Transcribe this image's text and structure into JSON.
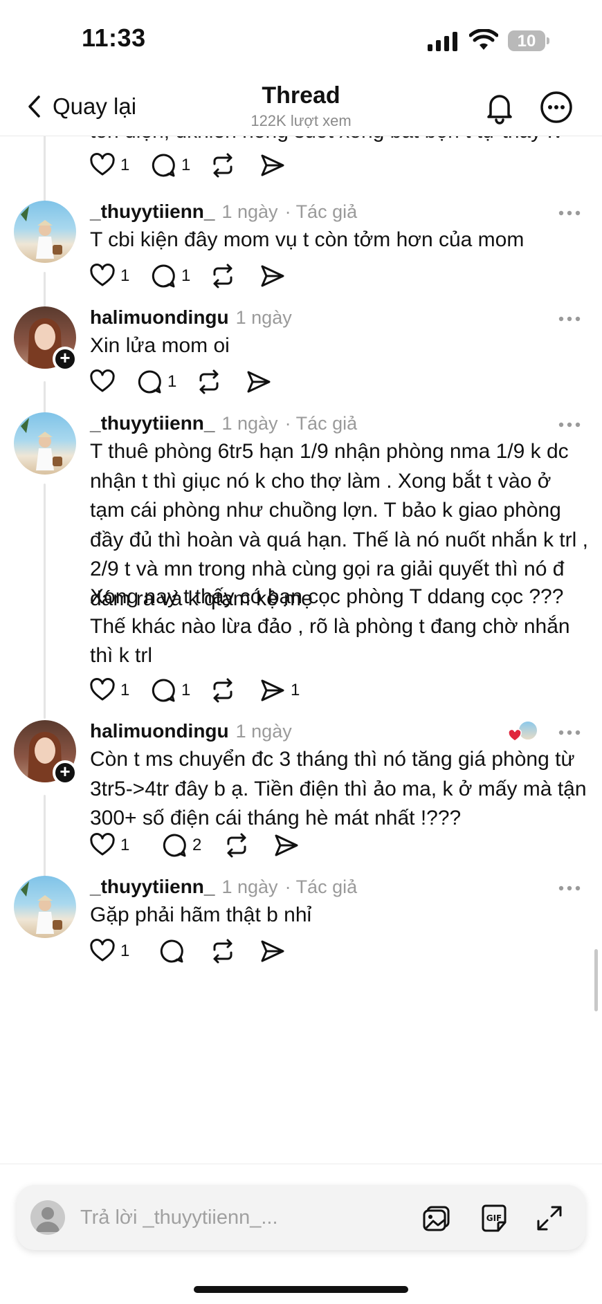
{
  "status_bar": {
    "time": "11:33",
    "battery": "10"
  },
  "header": {
    "back_label": "Quay lại",
    "title": "Thread",
    "subtitle": "122K lượt xem"
  },
  "replies": [
    {
      "username": "",
      "time": "",
      "author_tag": "",
      "text": "tốn điện, đkhien hỏng suốt xong bắt bọn t tự thay :v",
      "likes": "1",
      "comments": "1",
      "shares": ""
    },
    {
      "username": "_thuyytiienn_",
      "time": "1 ngày",
      "author_tag": "· Tác giả",
      "text": "T cbi kiện đây mom vụ t còn tởm hơn của mom",
      "likes": "1",
      "comments": "1",
      "shares": ""
    },
    {
      "username": "halimuondingu",
      "time": "1 ngày",
      "author_tag": "",
      "text": "Xin lửa mom oi",
      "likes": "",
      "comments": "1",
      "shares": ""
    },
    {
      "username": "_thuyytiienn_",
      "time": "1 ngày",
      "author_tag": "· Tác giả",
      "text": "T thuê phòng 6tr5 hạn 1/9 nhận phòng nma 1/9 k dc nhận t thì giục nó k cho thợ làm . Xong bắt t vào ở tạm cái phòng như chuồng lợn. T bảo k giao phòng đầy đủ thì hoàn và quá hạn. Thế là nó nuốt nhắn k trl , 2/9 t và mn trong nhà cùng gọi ra giải quyết thì nó đ dám ra và k qtam kệ mẹ",
      "text2": "Xong nay t thấy có bạn cọc phòng T ddang cọc ??? Thế khác nào lừa đảo , rõ là phòng t đang chờ nhắn thì k trl",
      "likes": "1",
      "comments": "1",
      "shares": "1"
    },
    {
      "username": "halimuondingu",
      "time": "1 ngày",
      "author_tag": "",
      "text": "Còn t ms chuyển đc 3 tháng thì nó tăng giá phòng từ 3tr5->4tr đây b ạ. Tiền điện thì ảo ma, k ở mấy mà tận 300+ số điện cái tháng hè mát nhất !???",
      "likes": "1",
      "comments": "2",
      "shares": ""
    },
    {
      "username": "_thuyytiienn_",
      "time": "1 ngày",
      "author_tag": "· Tác giả",
      "text": "Gặp phải hãm thật b nhỉ",
      "likes": "1",
      "comments": "",
      "shares": ""
    }
  ],
  "composer": {
    "placeholder": "Trả lời _thuyytiienn_..."
  },
  "colors": {
    "heart_red": "#e0263d",
    "meta_gray": "#9a9a9a",
    "line_gray": "#e5e5e5"
  },
  "icons": [
    "back-chevron-icon",
    "bell-icon",
    "more-circle-icon",
    "heart-icon",
    "comment-icon",
    "repost-icon",
    "send-icon",
    "image-icon",
    "gif-icon",
    "expand-icon"
  ]
}
